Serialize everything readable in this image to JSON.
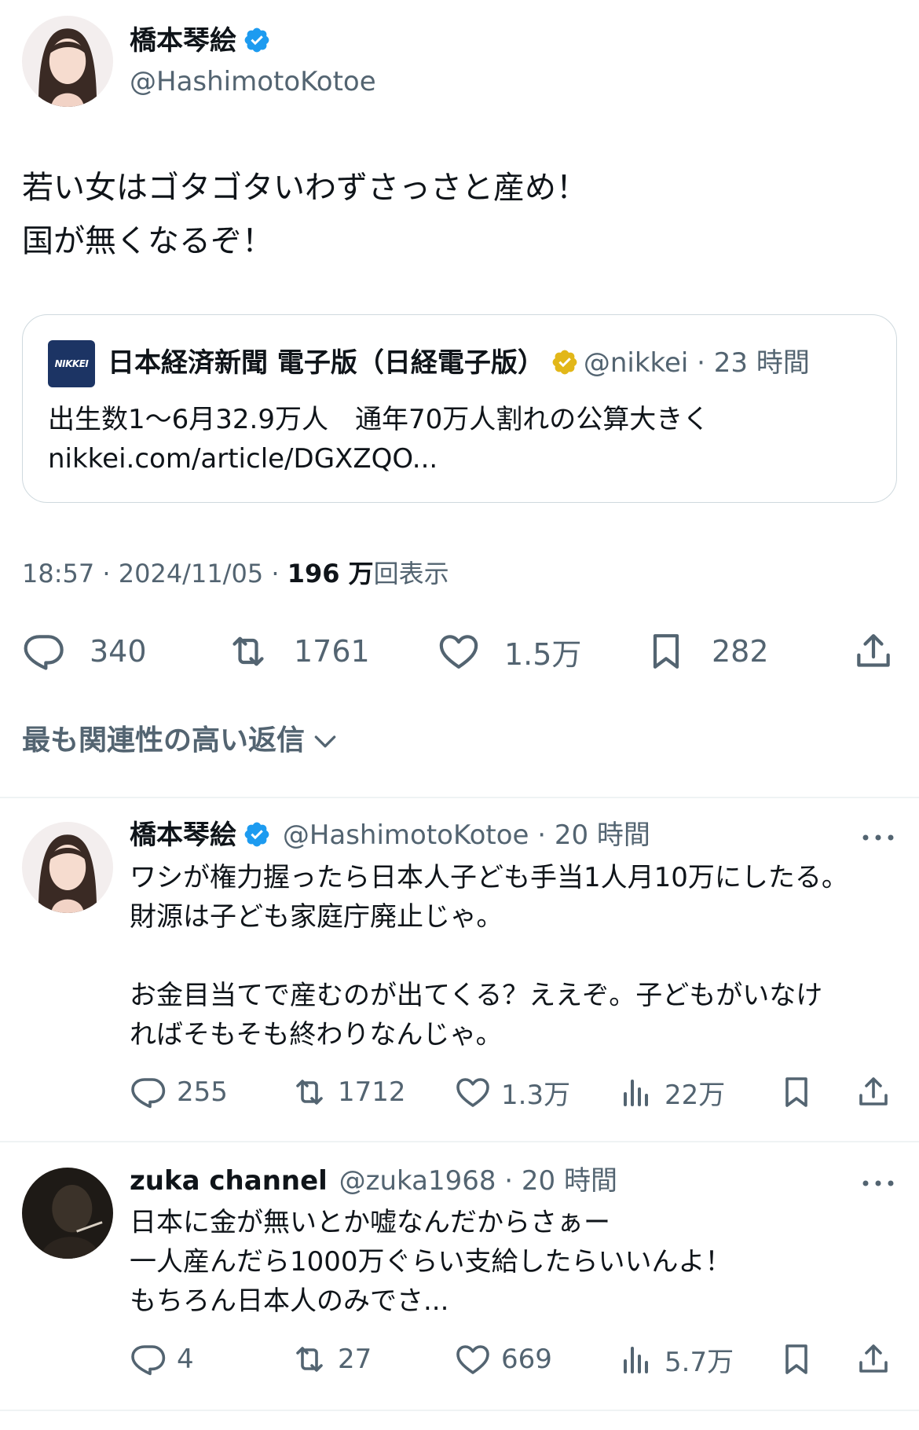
{
  "main_tweet": {
    "author_name": "橋本琴絵",
    "author_handle": "@HashimotoKotoe",
    "text_lines": [
      "若い女はゴタゴタいわずさっさと産め！",
      "国が無くなるぞ！"
    ],
    "quote": {
      "logo_text": "NIKKEI",
      "name": "日本経済新聞 電子版（日経電子版）",
      "handle_time": "@nikkei · 23 時間",
      "body_lines": [
        "出生数1〜6月32.9万人　通年70万人割れの公算大きく",
        "nikkei.com/article/DGXZQO..."
      ]
    },
    "meta": {
      "time_date": "18:57 · 2024/11/05 · ",
      "views_count": "196 万",
      "views_label": "回表示"
    },
    "actions": {
      "replies": "340",
      "retweets": "1761",
      "likes": "1.5万",
      "bookmarks": "282"
    }
  },
  "sort_label": "最も関連性の高い返信",
  "replies": [
    {
      "name": "橋本琴絵",
      "meta": "@HashimotoKotoe · 20 時間",
      "lines": [
        "ワシが権力握ったら日本人子ども手当1人月10万にしたる。",
        "財源は子ども家庭庁廃止じゃ。",
        "",
        "お金目当てで産むのが出てくる？ええぞ。子どもがいなけ",
        "ればそもそも終わりなんじゃ。"
      ],
      "replies": "255",
      "retweets": "1712",
      "likes": "1.3万",
      "views": "22万"
    },
    {
      "name": "zuka channel",
      "meta": "@zuka1968 · 20 時間",
      "lines": [
        "日本に金が無いとか嘘なんだからさぁー",
        "一人産んだら1000万ぐらい支給したらいいんよ！",
        "もちろん日本人のみでさ..."
      ],
      "replies": "4",
      "retweets": "27",
      "likes": "669",
      "views": "5.7万"
    }
  ],
  "colors": {
    "text": "#0f1419",
    "secondary": "#536471",
    "verified_blue": "#1d9bf0",
    "verified_gold": "#e2b719",
    "border": "#cfd9de",
    "nikkei_navy": "#1c3464"
  }
}
